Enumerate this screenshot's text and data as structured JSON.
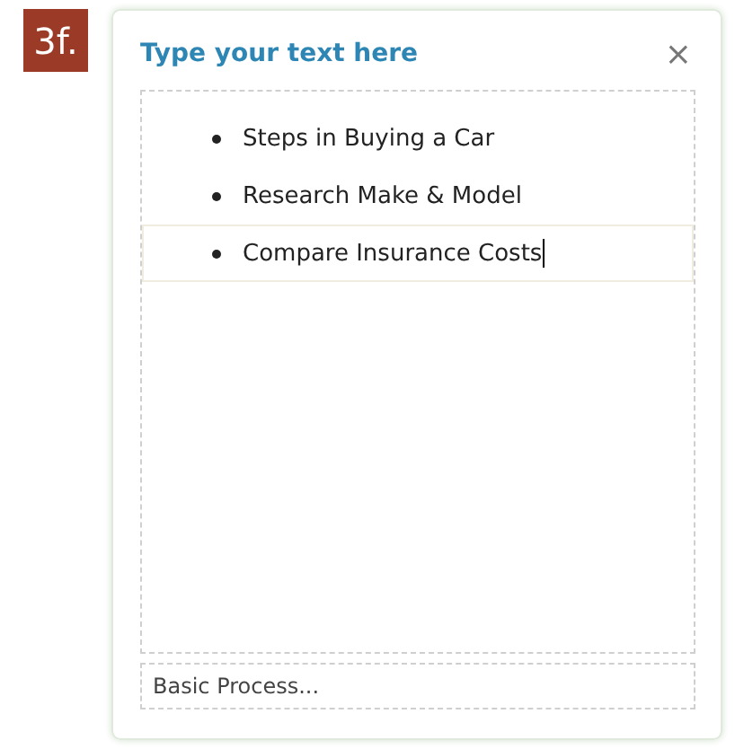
{
  "step_badge": "3f.",
  "pane": {
    "title": "Type your text here",
    "close": "×"
  },
  "bullets": [
    {
      "text": "Steps in Buying a Car",
      "selected": false
    },
    {
      "text": "Research Make & Model",
      "selected": false
    },
    {
      "text": "Compare Insurance Costs",
      "selected": true
    }
  ],
  "footer": {
    "label": "Basic Process..."
  }
}
